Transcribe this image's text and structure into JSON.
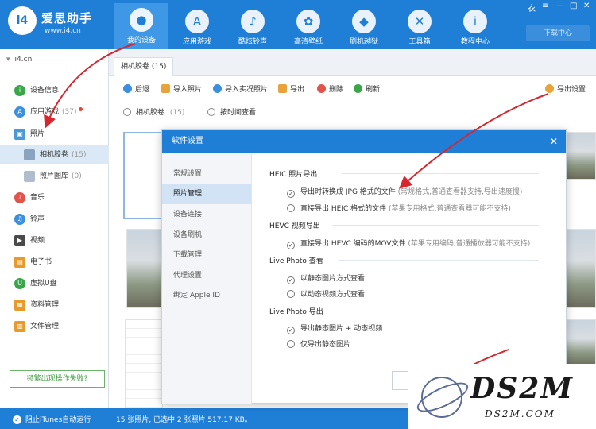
{
  "app": {
    "brand": "爱思助手",
    "url": "www.i4.cn",
    "logo": "i4"
  },
  "nav": [
    {
      "label": "我的设备",
      "icon": "apple-icon",
      "glyph": ""
    },
    {
      "label": "应用游戏",
      "icon": "app-store-icon",
      "glyph": "A"
    },
    {
      "label": "酷炫铃声",
      "icon": "bell-icon",
      "glyph": "🔔"
    },
    {
      "label": "高清壁纸",
      "icon": "flower-icon",
      "glyph": "✿"
    },
    {
      "label": "刷机越狱",
      "icon": "box-icon",
      "glyph": "◆"
    },
    {
      "label": "工具箱",
      "icon": "tools-icon",
      "glyph": "✕"
    },
    {
      "label": "教程中心",
      "icon": "info-icon",
      "glyph": "i"
    }
  ],
  "download_center": "下载中心",
  "window_controls": [
    "衣",
    "≡",
    "—",
    "□",
    "✕"
  ],
  "sidebar": {
    "device": "i4.cn",
    "items": [
      {
        "label": "设备信息",
        "color": "#3aa64a",
        "glyph": "i"
      },
      {
        "label": "应用游戏",
        "count": "(37)",
        "color": "#3b8fe0",
        "glyph": "A"
      },
      {
        "label": "照片",
        "color": "#4a9ad8",
        "glyph": "▣"
      },
      {
        "label": "相机胶卷",
        "count": "(15)"
      },
      {
        "label": "照片图库",
        "count": "(0)"
      },
      {
        "label": "音乐",
        "color": "#e2534a",
        "glyph": "♪"
      },
      {
        "label": "铃声",
        "color": "#3b8fe0",
        "glyph": "♫"
      },
      {
        "label": "视频",
        "color": "#4a4a4a",
        "glyph": "▶"
      },
      {
        "label": "电子书",
        "color": "#e89a2a",
        "glyph": "▤"
      },
      {
        "label": "虚拟U盘",
        "color": "#3aa64a",
        "glyph": "U"
      },
      {
        "label": "资料管理",
        "color": "#e89a2a",
        "glyph": "▦"
      },
      {
        "label": "文件管理",
        "color": "#e89a2a",
        "glyph": "▥"
      }
    ],
    "fail_button": "频繁出现操作失败?"
  },
  "tab": "相机胶卷 (15)",
  "toolbar": {
    "back": "后退",
    "import": "导入照片",
    "import_live": "导入实况照片",
    "export": "导出",
    "delete": "删除",
    "refresh": "刷新",
    "export_settings": "导出设置"
  },
  "filter": {
    "camera_roll": "相机胶卷",
    "camera_roll_count": "(15)",
    "by_time": "按时间查看"
  },
  "status": {
    "left": "阻止iTunes自动运行",
    "main": "15 张照片, 已选中 2 张照片 517.17 KB。"
  },
  "dialog": {
    "title": "软件设置",
    "close": "✕",
    "nav": [
      "常规设置",
      "照片管理",
      "设备连接",
      "设备刷机",
      "下载管理",
      "代理设置",
      "绑定 Apple ID"
    ],
    "sections": [
      {
        "title": "HEIC 照片导出",
        "options": [
          {
            "label": "导出时转换成 JPG 格式的文件",
            "hint": "(常规格式,普通查看器支持,导出速度慢)",
            "checked": true
          },
          {
            "label": "直接导出 HEIC 格式的文件",
            "hint": "(苹果专用格式,普通查看器可能不支持)",
            "checked": false
          }
        ]
      },
      {
        "title": "HEVC 视频导出",
        "options": [
          {
            "label": "直接导出 HEVC 编码的MOV文件",
            "hint": "(苹果专用编码,普通播放器可能不支持)",
            "checked": true
          }
        ]
      },
      {
        "title": "Live Photo 查看",
        "options": [
          {
            "label": "以静态图片方式查看",
            "hint": "",
            "checked": true
          },
          {
            "label": "以动态视频方式查看",
            "hint": "",
            "checked": false
          }
        ]
      },
      {
        "title": "Live Photo 导出",
        "options": [
          {
            "label": "导出静态图片 + 动态视频",
            "hint": "",
            "checked": true
          },
          {
            "label": "仅导出静态图片",
            "hint": "",
            "checked": false
          }
        ]
      }
    ]
  },
  "watermark": {
    "big": "DS2M",
    "small": "DS2M.COM"
  },
  "colors": {
    "brand": "#1f7ed6",
    "arrow": "#d8262e",
    "selected": "#dbe9f7"
  }
}
